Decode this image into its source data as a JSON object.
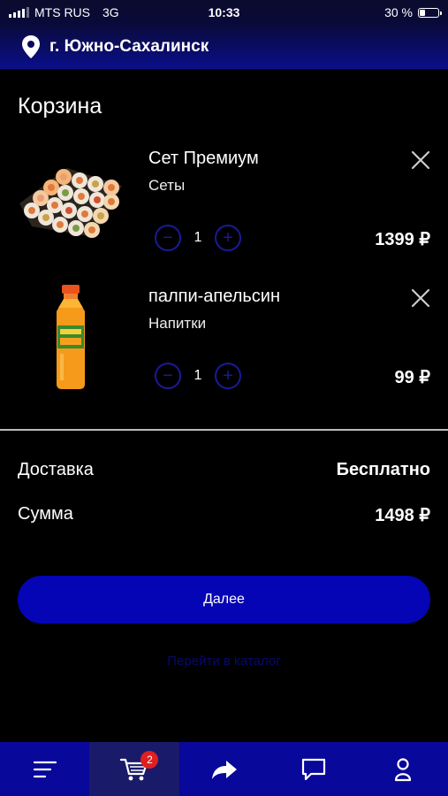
{
  "status_bar": {
    "carrier": "MTS RUS",
    "network": "3G",
    "time": "10:33",
    "battery": "30 %",
    "battery_level": 0.3
  },
  "header": {
    "city": "г. Южно-Сахалинск",
    "pin_icon": "location-pin-icon"
  },
  "page": {
    "title": "Корзина"
  },
  "cart": {
    "items": [
      {
        "name": "Сет Премиум",
        "category": "Сеты",
        "quantity": "1",
        "price": "1399 ₽",
        "image": "sushi-set-image"
      },
      {
        "name": "палпи-апельсин",
        "category": "Напитки",
        "quantity": "1",
        "price": "99 ₽",
        "image": "orange-juice-bottle-image"
      }
    ],
    "minus_symbol": "−",
    "plus_symbol": "+"
  },
  "summary": {
    "delivery_label": "Доставка",
    "delivery_value": "Бесплатно",
    "total_label": "Сумма",
    "total_value": "1498 ₽"
  },
  "actions": {
    "next_label": "Далее",
    "catalog_link": "Перейти в каталог"
  },
  "tab_bar": {
    "tabs": [
      {
        "icon": "menu-icon"
      },
      {
        "icon": "cart-icon",
        "badge": "2",
        "active": true
      },
      {
        "icon": "share-icon"
      },
      {
        "icon": "chat-icon"
      },
      {
        "icon": "user-icon"
      }
    ]
  },
  "colors": {
    "accent": "#0505b5",
    "tab_bar": "#08089a",
    "badge": "#e02020"
  }
}
